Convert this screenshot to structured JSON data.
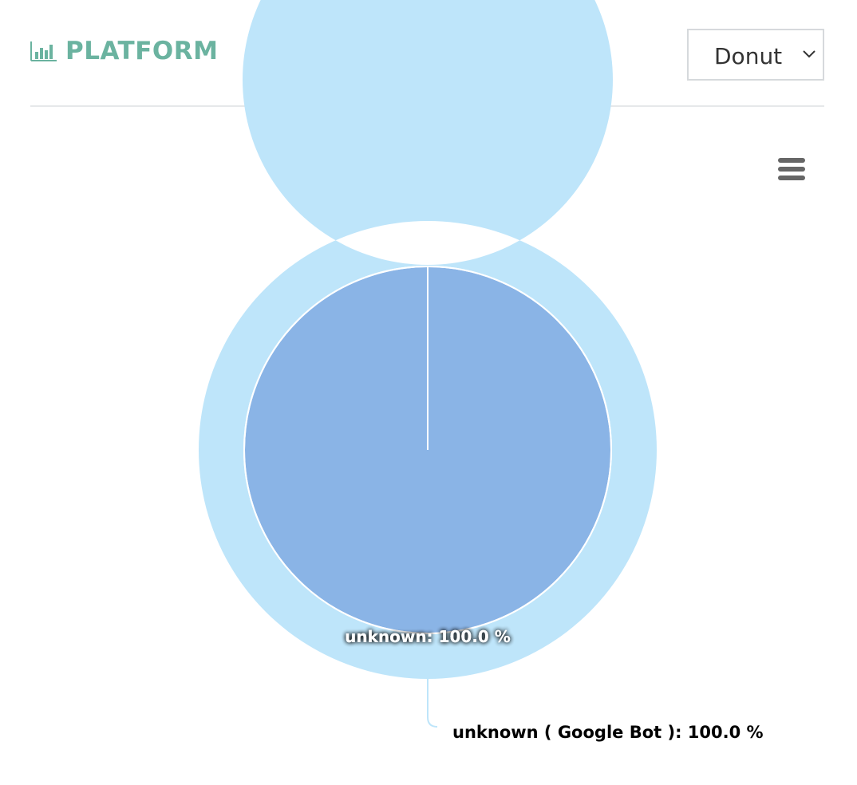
{
  "header": {
    "title": "PLATFORM",
    "title_icon": "bar-chart-icon",
    "title_color": "#6bb3a0"
  },
  "chart_type_select": {
    "selected": "Donut",
    "icon": "chevron-down-icon"
  },
  "export_menu": {
    "icon": "hamburger-menu-icon"
  },
  "chart_data": {
    "type": "pie",
    "variant": "donut-nested",
    "inner_series": {
      "slices": [
        {
          "label": "unknown: 100.0 %",
          "name": "unknown",
          "value": 100.0,
          "color": "#8ab4e6"
        }
      ]
    },
    "outer_series": {
      "slices": [
        {
          "label": "unknown ( Google Bot ): 100.0 %",
          "name": "unknown ( Google Bot )",
          "value": 100.0,
          "color": "#bee5fa"
        }
      ]
    }
  }
}
